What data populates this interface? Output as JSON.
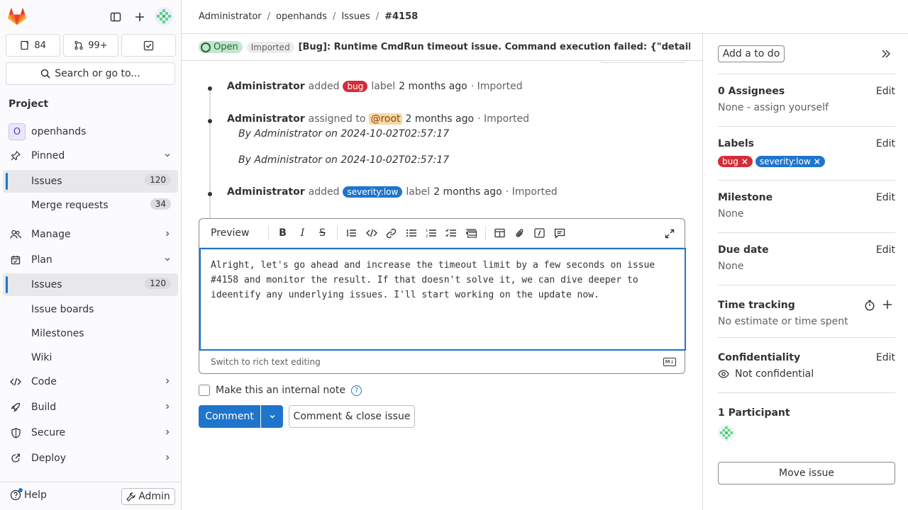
{
  "sidebar": {
    "counts": {
      "issues": "84",
      "mrs": "99+"
    },
    "search_label": "Search or go to...",
    "section_title": "Project",
    "project_initial": "O",
    "project_name": "openhands",
    "pinned_label": "Pinned",
    "pinned_items": [
      {
        "label": "Issues",
        "count": "120"
      },
      {
        "label": "Merge requests",
        "count": "34"
      }
    ],
    "manage_label": "Manage",
    "plan_label": "Plan",
    "plan_items": [
      {
        "label": "Issues",
        "count": "120"
      },
      {
        "label": "Issue boards"
      },
      {
        "label": "Milestones"
      },
      {
        "label": "Wiki"
      }
    ],
    "code_label": "Code",
    "build_label": "Build",
    "secure_label": "Secure",
    "deploy_label": "Deploy",
    "help_label": "Help",
    "admin_label": "Admin"
  },
  "breadcrumb": {
    "items": [
      "Administrator",
      "openhands",
      "Issues",
      "#4158"
    ],
    "sep": "/"
  },
  "issue": {
    "status": "Open",
    "imported": "Imported",
    "title": "[Bug]: Runtime CmdRun timeout issue. Command execution failed: {\"detail\":\"..."
  },
  "timeline": {
    "item1": {
      "author": "Administrator",
      "action": "added",
      "label": "bug",
      "suffix": "label",
      "time": "2 months ago",
      "meta": "· Imported"
    },
    "item2": {
      "author": "Administrator",
      "action": "assigned to",
      "mention": "@root",
      "time": "2 months ago",
      "meta": "· Imported",
      "byline1": "By Administrator on 2024-10-02T02:57:17",
      "byline2": "By Administrator on 2024-10-02T02:57:17"
    },
    "item3": {
      "author": "Administrator",
      "action": "added",
      "label": "severity::low",
      "label_display": "severity:low",
      "suffix": "label",
      "time": "2 months ago",
      "meta": "· Imported"
    }
  },
  "editor": {
    "preview_label": "Preview",
    "text": "Alright, let's go ahead and increase the timeout limit by a few seconds on issue\n#4158 and monitor the result. If that doesn't solve it, we can dive deeper to\nideentify any underlying issues. I'll start working on the update now.",
    "switch_label": "Switch to rich text editing",
    "md_badge": "M↓"
  },
  "internal_note_label": "Make this an internal note",
  "buttons": {
    "comment": "Comment",
    "close": "Comment & close issue"
  },
  "right_sidebar": {
    "todo": "Add a to do",
    "assignees_title": "0 Assignees",
    "assignees_value": "None - assign yourself",
    "labels_title": "Labels",
    "labels": [
      {
        "name": "bug",
        "color": "#d42d3a"
      },
      {
        "name": "severity:low",
        "color": "#1f75cb"
      }
    ],
    "milestone_title": "Milestone",
    "milestone_value": "None",
    "due_title": "Due date",
    "due_value": "None",
    "time_title": "Time tracking",
    "time_value": "No estimate or time spent",
    "conf_title": "Confidentiality",
    "conf_value": "Not confidential",
    "participants_title": "1 Participant",
    "edit": "Edit",
    "move": "Move issue"
  },
  "colors": {
    "accent": "#1f75cb",
    "open_bg": "#c3e6cd",
    "bug": "#d42d3a"
  }
}
